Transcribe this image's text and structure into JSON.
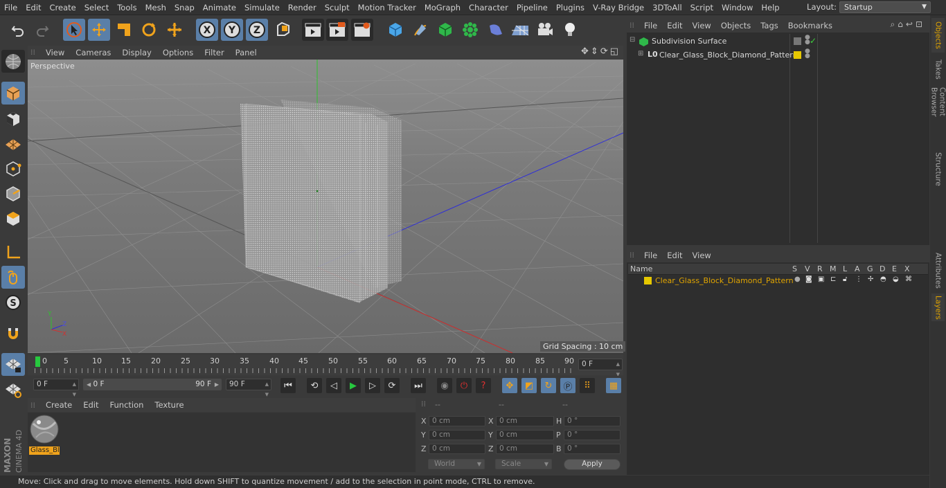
{
  "menu": [
    "File",
    "Edit",
    "Create",
    "Select",
    "Tools",
    "Mesh",
    "Snap",
    "Animate",
    "Simulate",
    "Render",
    "Sculpt",
    "Motion Tracker",
    "MoGraph",
    "Character",
    "Pipeline",
    "Plugins",
    "V-Ray Bridge",
    "3DToAll",
    "Script",
    "Window",
    "Help"
  ],
  "layout": {
    "label": "Layout:",
    "value": "Startup"
  },
  "axis_buttons": [
    "X",
    "Y",
    "Z"
  ],
  "viewport": {
    "menu": [
      "View",
      "Cameras",
      "Display",
      "Options",
      "Filter",
      "Panel"
    ],
    "label": "Perspective",
    "grid_spacing": "Grid Spacing : 10 cm"
  },
  "timeline": {
    "ticks": [
      "0",
      "5",
      "10",
      "15",
      "20",
      "25",
      "30",
      "35",
      "40",
      "45",
      "50",
      "55",
      "60",
      "65",
      "70",
      "75",
      "80",
      "85",
      "90"
    ],
    "current_frame": "0 F",
    "start_frame": "0 F",
    "range_start": "0 F",
    "range_end": "90 F",
    "end_frame": "90 F"
  },
  "material": {
    "menu": [
      "Create",
      "Edit",
      "Function",
      "Texture"
    ],
    "items": [
      {
        "name": "Glass_Bl"
      }
    ]
  },
  "coords": {
    "headers": [
      "--",
      "--",
      "--"
    ],
    "rows": [
      {
        "l1": "X",
        "v1": "0 cm",
        "l2": "X",
        "v2": "0 cm",
        "l3": "H",
        "v3": "0 °"
      },
      {
        "l1": "Y",
        "v1": "0 cm",
        "l2": "Y",
        "v2": "0 cm",
        "l3": "P",
        "v3": "0 °"
      },
      {
        "l1": "Z",
        "v1": "0 cm",
        "l2": "Z",
        "v2": "0 cm",
        "l3": "B",
        "v3": "0 °"
      }
    ],
    "mode": "World",
    "scale": "Scale",
    "apply": "Apply"
  },
  "objects": {
    "menu": [
      "File",
      "Edit",
      "View",
      "Objects",
      "Tags",
      "Bookmarks"
    ],
    "items": [
      "Subdivision Surface",
      "Clear_Glass_Block_Diamond_Pattern"
    ]
  },
  "layers": {
    "menu": [
      "File",
      "Edit",
      "View"
    ],
    "columns": [
      "Name",
      "S",
      "V",
      "R",
      "M",
      "L",
      "A",
      "G",
      "D",
      "E",
      "X"
    ],
    "items": [
      "Clear_Glass_Block_Diamond_Pattern"
    ]
  },
  "side_tabs": [
    "Objects",
    "Takes",
    "Content Browser",
    "Structure",
    "Attributes",
    "Layers"
  ],
  "brand": {
    "maxon": "MAXON",
    "product": "CINEMA 4D"
  },
  "status": "Move: Click and drag to move elements. Hold down SHIFT to quantize movement / add to the selection in point mode, CTRL to remove.",
  "colors": {
    "accent": "#5a7fa8",
    "layer": "#e6c800",
    "active_text": "#e0a400",
    "timeline_marker": "#27c93f"
  }
}
